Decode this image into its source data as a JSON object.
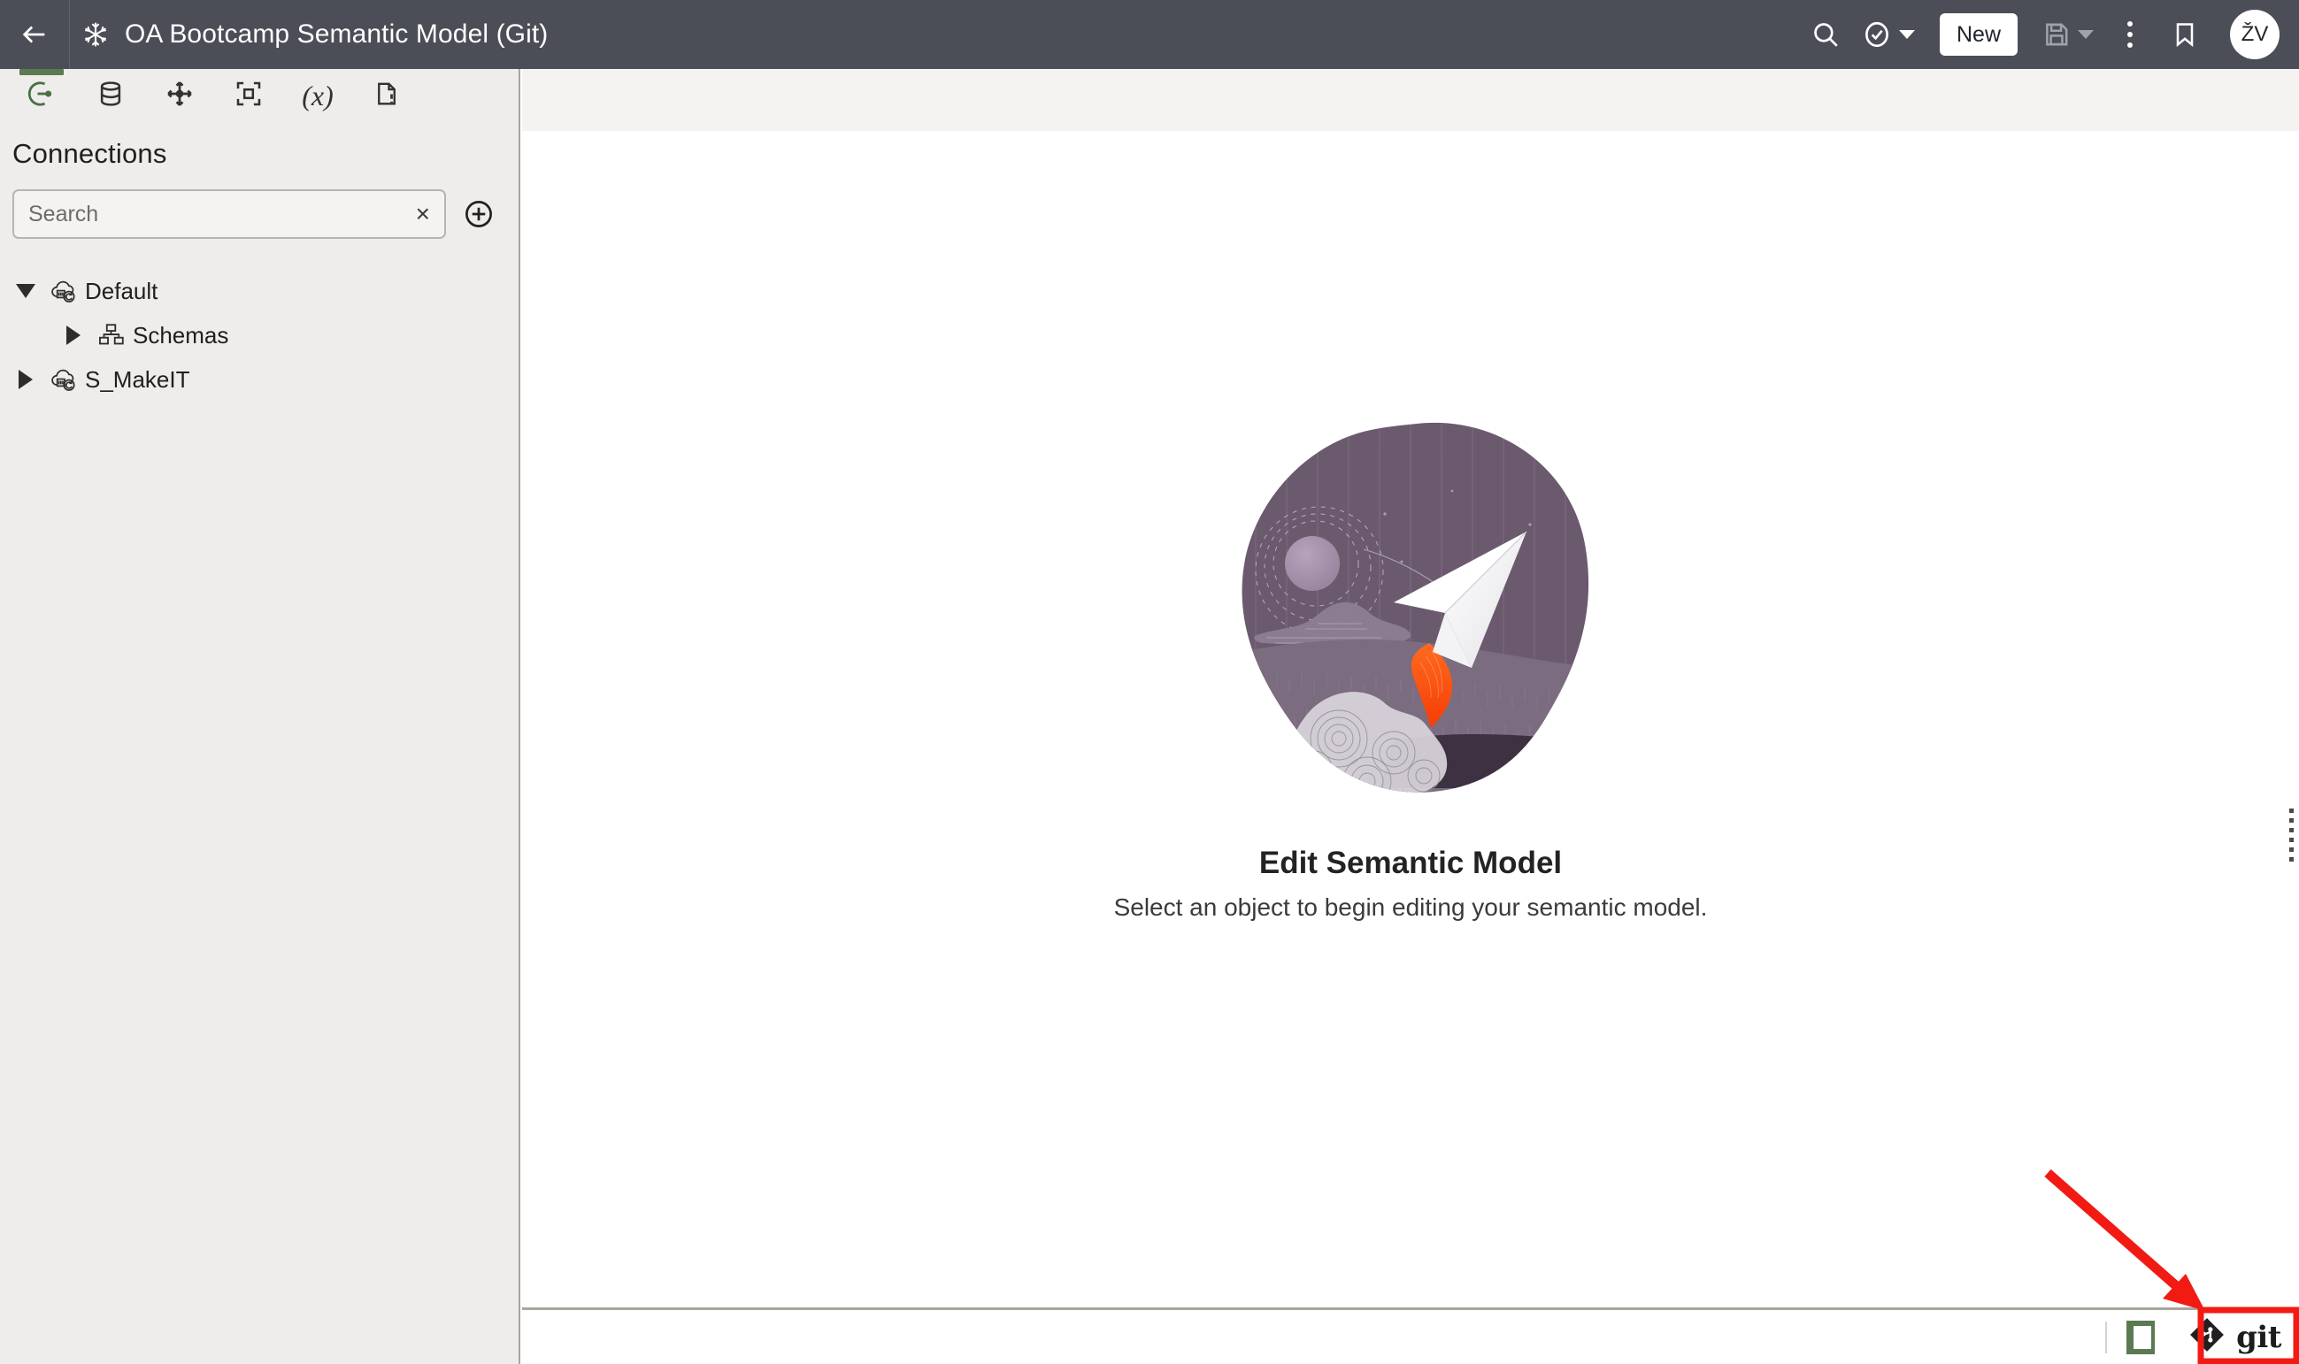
{
  "titlebar": {
    "back_label": "Back",
    "logo_icon": "snowflake-icon",
    "title": "OA Bootcamp Semantic Model (Git)",
    "search_icon": "search-icon",
    "validate_icon": "check-circle-icon",
    "new_label": "New",
    "save_icon": "save-icon",
    "more_icon": "kebab-menu-icon",
    "bookmark_icon": "bookmark-icon",
    "avatar_initials": "ŽV"
  },
  "sidebar": {
    "tabs": [
      {
        "name": "connections",
        "icon": "connection-icon",
        "active": true
      },
      {
        "name": "databases",
        "icon": "database-icon",
        "active": false
      },
      {
        "name": "relationships",
        "icon": "move-arrows-icon",
        "active": false
      },
      {
        "name": "dimensions",
        "icon": "crop-frame-icon",
        "active": false
      },
      {
        "name": "metrics",
        "icon": "variable-x-icon",
        "active": false
      },
      {
        "name": "issues",
        "icon": "document-warning-icon",
        "active": false
      }
    ],
    "panel_title": "Connections",
    "search": {
      "value": "",
      "placeholder": "Search",
      "clear_label": "×",
      "add_label": "Add connection"
    },
    "tree": [
      {
        "label": "Default",
        "icon": "cloud-database-icon",
        "expanded": true,
        "depth": 0
      },
      {
        "label": "Schemas",
        "icon": "schema-icon",
        "expanded": false,
        "depth": 1
      },
      {
        "label": "S_MakeIT",
        "icon": "cloud-database-icon",
        "expanded": false,
        "depth": 0
      }
    ]
  },
  "main": {
    "empty_state": {
      "illustration": "paper-airplane-rocket-illustration",
      "title": "Edit Semantic Model",
      "subtitle": "Select an object to begin editing your semantic model."
    }
  },
  "statusbar": {
    "panel_toggle_icon": "side-panel-toggle-icon",
    "git_icon": "git-logo-icon",
    "git_label": "git"
  },
  "annotation": {
    "arrow": "red-arrow-pointing-to-git-button",
    "highlight": "red-rectangle-around-git-button",
    "color": "#f21b13"
  },
  "colors": {
    "titlebar_bg": "#4b4e57",
    "sidebar_bg": "#eeedeb",
    "accent_green": "#5b7a52",
    "canvas_bg": "#ffffff",
    "strip_bg": "#f4f3f1",
    "illustration_purple": "#6b5a6e",
    "illustration_purple_mid": "#7b6c80",
    "illustration_purple_dark": "#3d3142",
    "illustration_flame": "#fa4616",
    "annotation_red": "#f21b13"
  }
}
